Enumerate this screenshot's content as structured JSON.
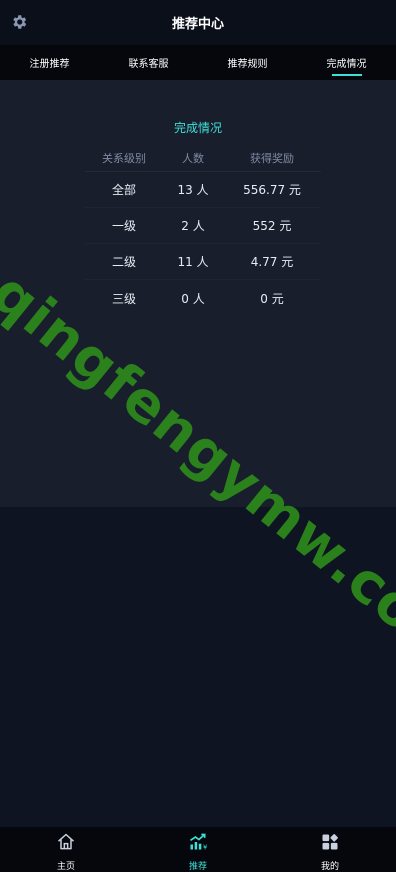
{
  "header": {
    "title": "推荐中心",
    "settings_icon": "gear-icon"
  },
  "tabs": [
    {
      "label": "注册推荐",
      "active": false
    },
    {
      "label": "联系客服",
      "active": false
    },
    {
      "label": "推荐规则",
      "active": false
    },
    {
      "label": "完成情况",
      "active": true
    }
  ],
  "summary": {
    "title": "完成情况",
    "columns": [
      "关系级别",
      "人数",
      "获得奖励"
    ],
    "rows": [
      {
        "level": "全部",
        "count": "13 人",
        "reward": "556.77 元"
      },
      {
        "level": "一级",
        "count": "2 人",
        "reward": "552 元"
      },
      {
        "level": "二级",
        "count": "11 人",
        "reward": "4.77 元"
      },
      {
        "level": "三级",
        "count": "0 人",
        "reward": "0 元"
      }
    ]
  },
  "watermark": "qingfengymw.com",
  "bottom_nav": [
    {
      "label": "主页",
      "icon": "home-icon",
      "active": false
    },
    {
      "label": "推荐",
      "icon": "chart-growth-icon",
      "active": true
    },
    {
      "label": "我的",
      "icon": "apps-icon",
      "active": false
    }
  ],
  "colors": {
    "accent": "#3ee0d6",
    "background": "#0f1422",
    "panel": "#181e2c",
    "watermark": "#2d8a1a"
  }
}
